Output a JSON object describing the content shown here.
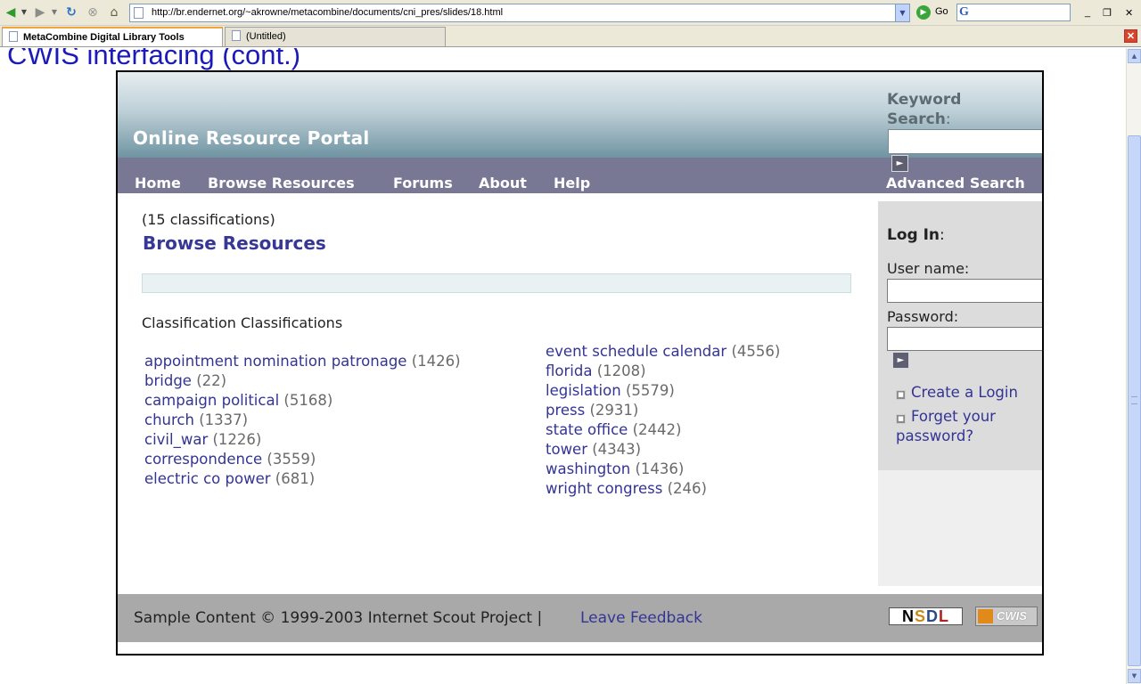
{
  "browser": {
    "url": "http://br.endernet.org/~akrowne/metacombine/documents/cni_pres/slides/18.html",
    "go_label": "Go",
    "search_engine_glyph": "G",
    "tabs": [
      {
        "label": "MetaCombine Digital Library Tools",
        "active": true
      },
      {
        "label": "(Untitled)",
        "active": false
      }
    ],
    "window_controls": {
      "minimize": "_",
      "restore": "❐",
      "close": "✕"
    },
    "icons": [
      "back-arrow-icon",
      "forward-arrow-icon",
      "reload-icon",
      "stop-icon",
      "home-icon",
      "page-icon",
      "go-icon",
      "close-tab-icon"
    ]
  },
  "slide": {
    "title": "CWIS interfacing (cont.)"
  },
  "portal": {
    "site_name": "Online Resource Portal",
    "keyword_search": {
      "label": "Keyword Search",
      "colon": ":",
      "value": ""
    },
    "nav": [
      "Home",
      "Browse Resources",
      "Forums",
      "About",
      "Help"
    ],
    "advanced_search": "Advanced Search",
    "classification_count": "(15 classifications)",
    "heading": "Browse Resources",
    "subheading": "Classification Classifications",
    "classifications_left": [
      {
        "name": "appointment nomination patronage",
        "count": "(1426)"
      },
      {
        "name": "bridge",
        "count": "(22)"
      },
      {
        "name": "campaign political",
        "count": "(5168)"
      },
      {
        "name": "church",
        "count": "(1337)"
      },
      {
        "name": "civil_war",
        "count": "(1226)"
      },
      {
        "name": "correspondence",
        "count": "(3559)"
      },
      {
        "name": "electric co power",
        "count": "(681)"
      }
    ],
    "classifications_right": [
      {
        "name": "event schedule calendar",
        "count": "(4556)"
      },
      {
        "name": "florida",
        "count": "(1208)"
      },
      {
        "name": "legislation",
        "count": "(5579)"
      },
      {
        "name": "press",
        "count": "(2931)"
      },
      {
        "name": "state office",
        "count": "(2442)"
      },
      {
        "name": "tower",
        "count": "(4343)"
      },
      {
        "name": "washington",
        "count": "(1436)"
      },
      {
        "name": "wright congress",
        "count": "(246)"
      }
    ],
    "login": {
      "title": "Log In",
      "colon": ":",
      "username_label": "User name:",
      "password_label": "Password:",
      "create_login": "Create a Login",
      "forgot_line1": "Forget your",
      "forgot_line2": "password?"
    },
    "footer": {
      "text": "Sample Content © 1999-2003 Internet Scout Project   |",
      "feedback": "Leave Feedback",
      "logos": {
        "nsdl": [
          "N",
          "S",
          "D",
          "L"
        ],
        "cwis": "CWIS"
      }
    },
    "colors": {
      "header_top": "#e6edf0",
      "header_bottom": "#6f94a2",
      "nav_bg": "#787894",
      "link": "#343495",
      "footer_bg": "#a9a9a9"
    }
  }
}
